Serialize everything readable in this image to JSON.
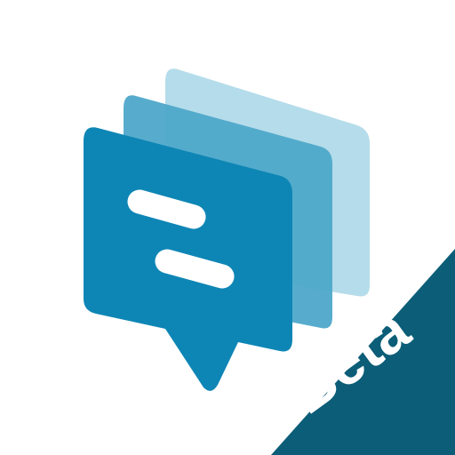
{
  "icon": {
    "name": "chat-stack-icon",
    "badge_label": "Beta"
  },
  "colors": {
    "background": "#ffffff",
    "back_card": "#b5dcea",
    "middle_card": "#4ea8ca",
    "front_bubble": "#0e86b5",
    "bubble_lines": "#ffffff",
    "beta_ribbon": "#0c5d77",
    "beta_text": "#ffffff"
  }
}
